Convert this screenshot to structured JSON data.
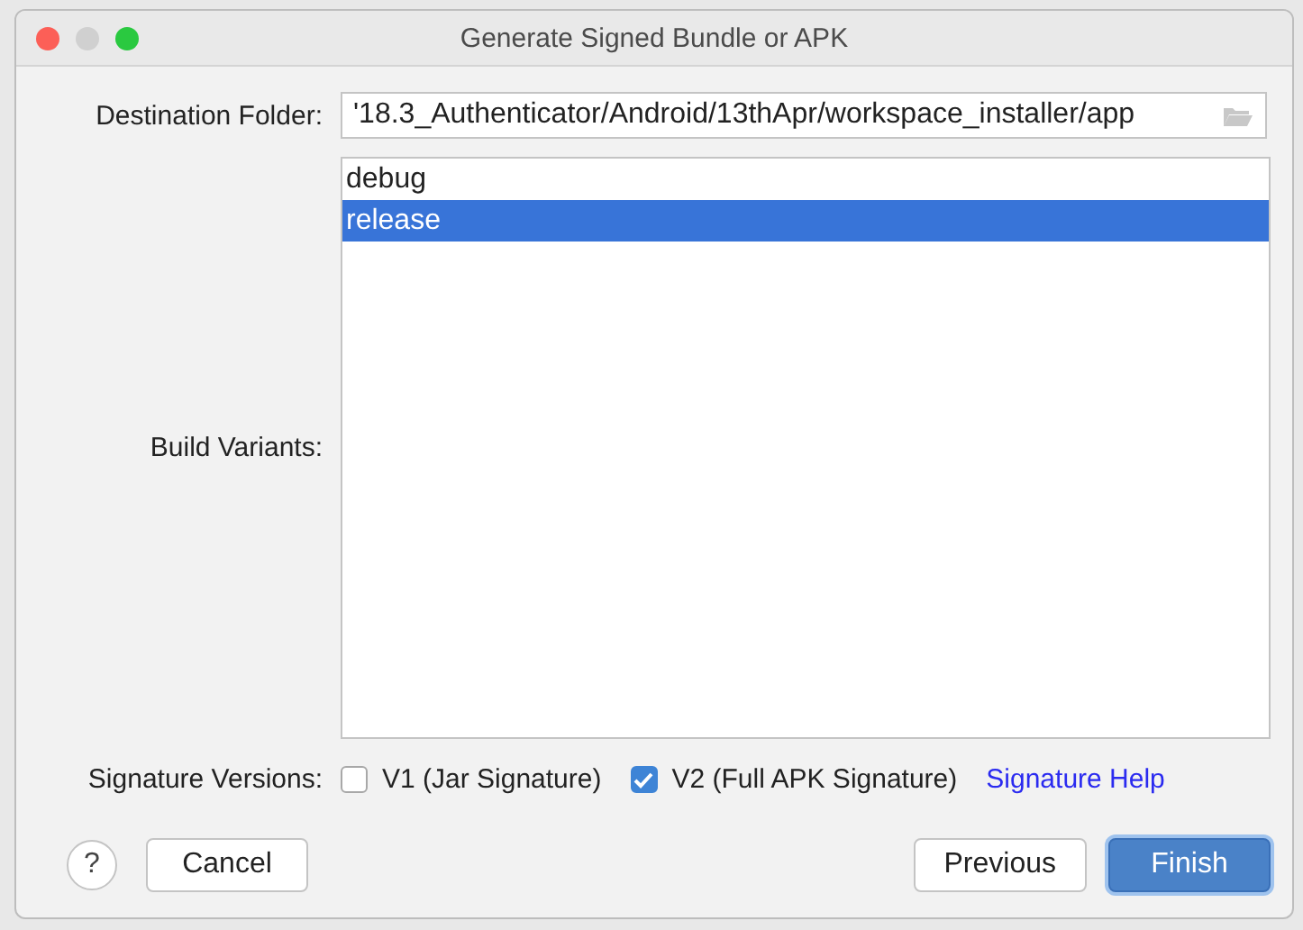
{
  "window": {
    "title": "Generate Signed Bundle or APK"
  },
  "destination_folder": {
    "label": "Destination Folder:",
    "value": "'18.3_Authenticator/Android/13thApr/workspace_installer/app"
  },
  "build_variants": {
    "label": "Build Variants:",
    "items": [
      {
        "label": "debug",
        "selected": false
      },
      {
        "label": "release",
        "selected": true
      }
    ]
  },
  "signature_versions": {
    "label": "Signature Versions:",
    "options": [
      {
        "label": "V1 (Jar Signature)",
        "checked": false
      },
      {
        "label": "V2 (Full APK Signature)",
        "checked": true
      }
    ],
    "help_link": "Signature Help"
  },
  "buttons": [
    {
      "label": "Cancel",
      "kind": "secondary"
    },
    {
      "label": "Previous",
      "kind": "secondary"
    },
    {
      "label": "Finish",
      "kind": "primary"
    }
  ],
  "help_button": "?"
}
